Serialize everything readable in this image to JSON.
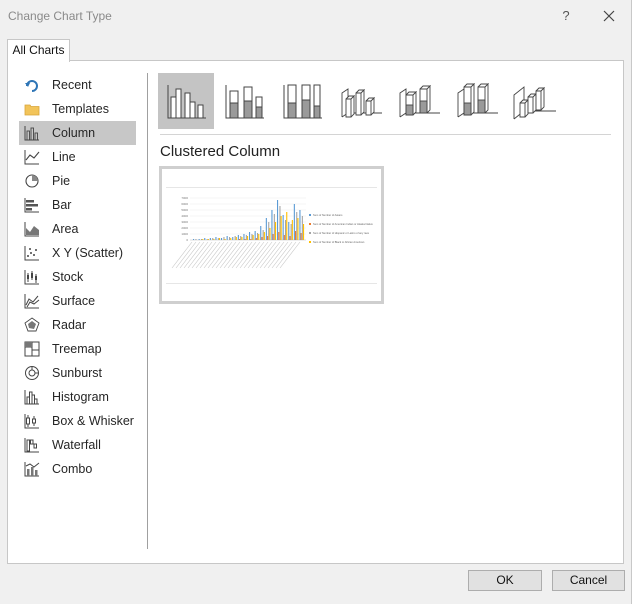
{
  "window": {
    "title": "Change Chart Type",
    "help": "?"
  },
  "tabs": [
    {
      "label": "All Charts"
    }
  ],
  "sidebar": {
    "items": [
      {
        "label": "Recent",
        "icon": "recent-icon"
      },
      {
        "label": "Templates",
        "icon": "folder-icon"
      },
      {
        "label": "Column",
        "icon": "column-chart-icon",
        "selected": true
      },
      {
        "label": "Line",
        "icon": "line-chart-icon"
      },
      {
        "label": "Pie",
        "icon": "pie-chart-icon"
      },
      {
        "label": "Bar",
        "icon": "bar-chart-icon"
      },
      {
        "label": "Area",
        "icon": "area-chart-icon"
      },
      {
        "label": "X Y (Scatter)",
        "icon": "scatter-chart-icon"
      },
      {
        "label": "Stock",
        "icon": "stock-chart-icon"
      },
      {
        "label": "Surface",
        "icon": "surface-chart-icon"
      },
      {
        "label": "Radar",
        "icon": "radar-chart-icon"
      },
      {
        "label": "Treemap",
        "icon": "treemap-icon"
      },
      {
        "label": "Sunburst",
        "icon": "sunburst-icon"
      },
      {
        "label": "Histogram",
        "icon": "histogram-icon"
      },
      {
        "label": "Box & Whisker",
        "icon": "box-whisker-icon"
      },
      {
        "label": "Waterfall",
        "icon": "waterfall-icon"
      },
      {
        "label": "Combo",
        "icon": "combo-chart-icon"
      }
    ]
  },
  "main": {
    "subtype_icons": [
      "clustered-column-icon",
      "stacked-column-icon",
      "100-stacked-column-icon",
      "3d-clustered-column-icon",
      "3d-stacked-column-icon",
      "3d-100-stacked-column-icon",
      "3d-column-icon"
    ],
    "selected_subtype_index": 0,
    "selected_subtype_name": "Clustered Column",
    "preview": {
      "legend": [
        "Sum of Number of Asians",
        "Sum of Number of American Indian or Alaska Native",
        "Sum of Number of Hispanic or Latino of any race",
        "Sum of Number of Black or African American"
      ],
      "series_colors": [
        "#5b9bd5",
        "#ed7d31",
        "#a5a5a5",
        "#ffc000"
      ],
      "y_ticks": [
        "7000",
        "6000",
        "5000",
        "4000",
        "3000",
        "2000",
        "1000",
        "0"
      ]
    }
  },
  "buttons": {
    "ok": "OK",
    "cancel": "Cancel"
  },
  "colors": {
    "selection": "#c7c7c7",
    "panel": "#ffffff",
    "chrome": "#f0f0f0",
    "icon_blue": "#2e75b6",
    "icon_yellow": "#f2c45a"
  }
}
